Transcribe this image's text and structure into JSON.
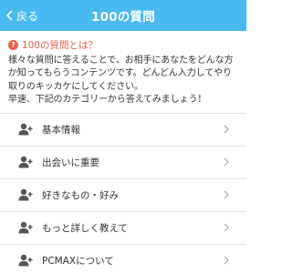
{
  "header": {
    "back_label": "戻る",
    "title": "100の質問"
  },
  "intro": {
    "heading": "100の質問とは？",
    "paragraph": "様々な質問に答えることで、お相手にあなたをどんな方か知ってもらうコンテンツです。どんどん入力してやり取りのキッカケにしてください。",
    "cta": "早速、下記のカテゴリーから答えてみましょう！"
  },
  "categories": [
    {
      "label": "基本情報",
      "icon": "user-plus-icon"
    },
    {
      "label": "出会いに重要",
      "icon": "user-plus-icon"
    },
    {
      "label": "好きなもの・好み",
      "icon": "user-plus-icon"
    },
    {
      "label": "もっと詳しく教えて",
      "icon": "user-plus-icon"
    },
    {
      "label": "PCMAXについて",
      "icon": "user-plus-icon"
    }
  ],
  "colors": {
    "header_bg": "#49b9f1",
    "accent": "#e8604c"
  }
}
